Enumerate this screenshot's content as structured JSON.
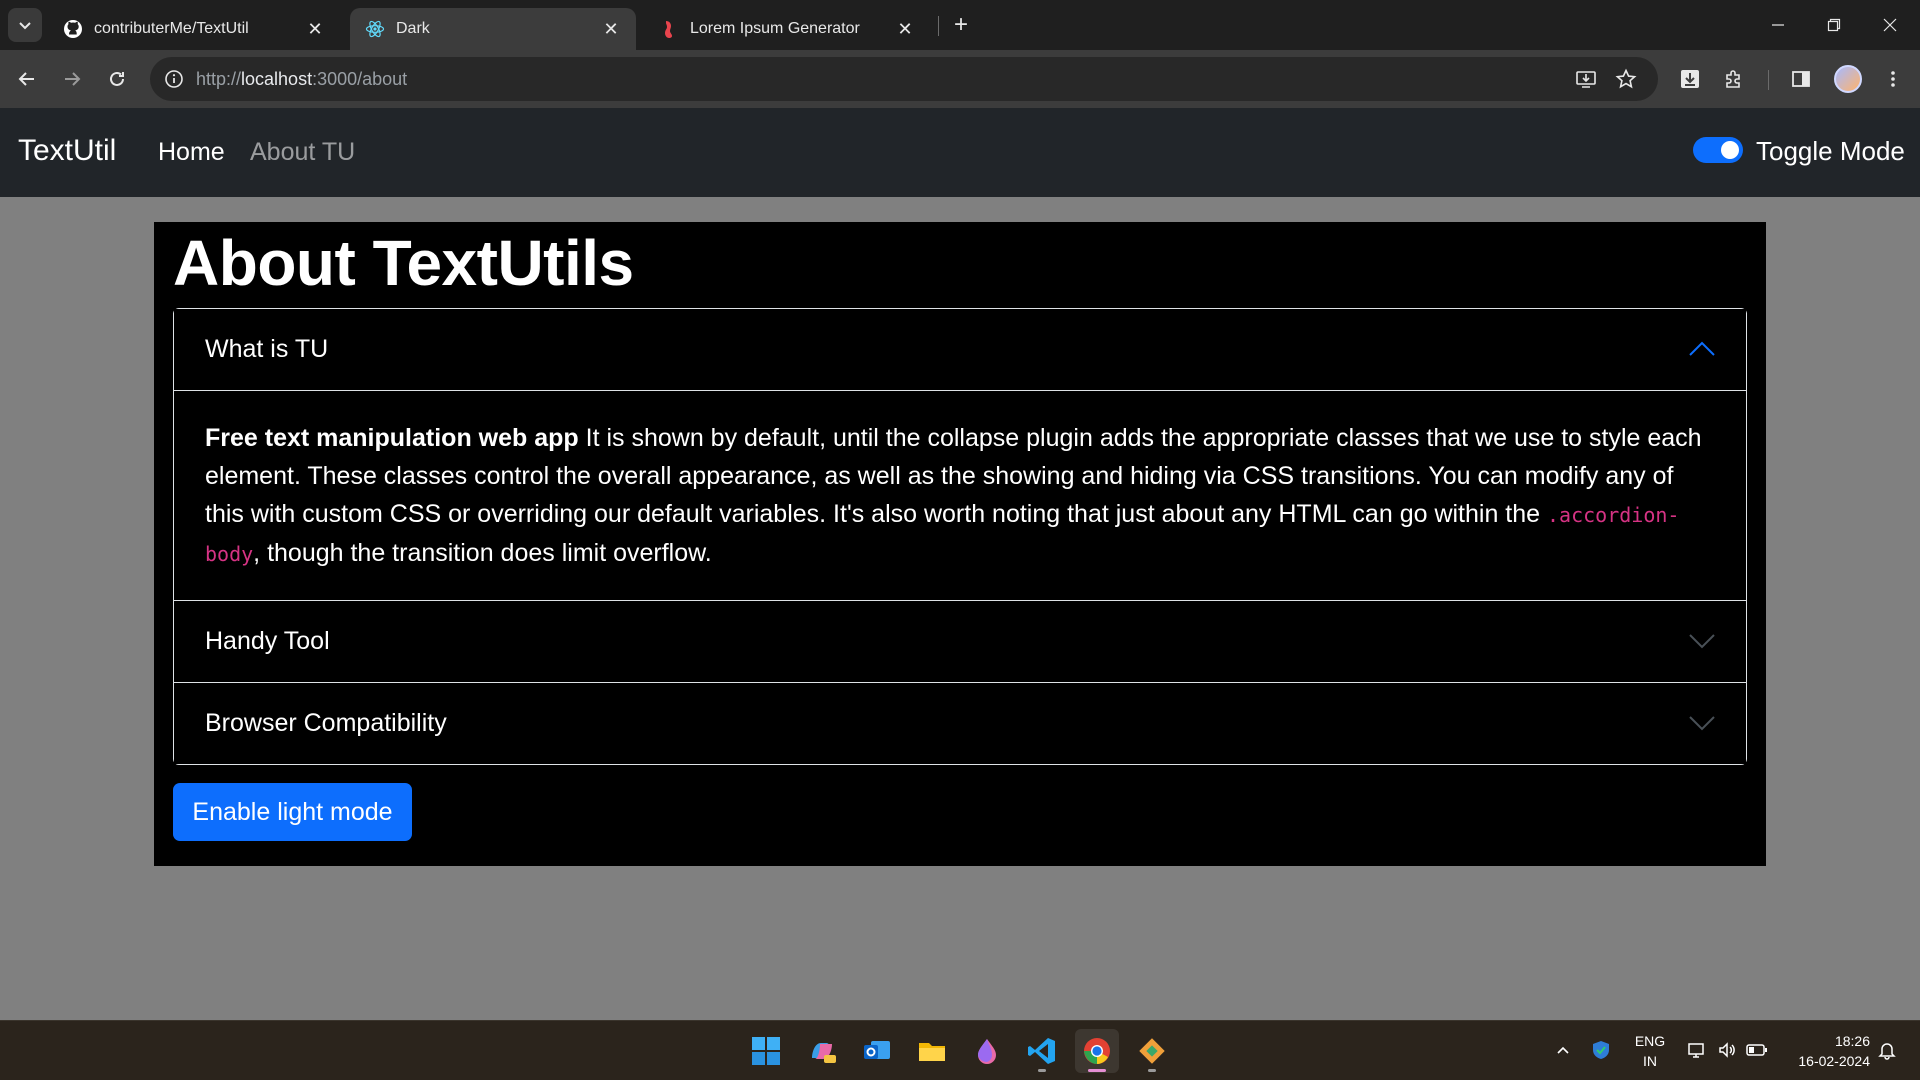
{
  "browser": {
    "tabs": [
      {
        "title": "contributerMe/TextUtil",
        "favicon": "github-icon",
        "active": false
      },
      {
        "title": "Dark",
        "favicon": "react-icon",
        "active": true
      },
      {
        "title": "Lorem Ipsum Generator",
        "favicon": "lorem-ipsum-icon",
        "active": false
      }
    ],
    "url_prefix": "http://",
    "url_host": "localhost",
    "url_path": ":3000/about"
  },
  "navbar": {
    "brand": "TextUtil",
    "links": [
      {
        "label": "Home",
        "active": true
      },
      {
        "label": "About TU",
        "active": false
      }
    ],
    "toggle_label": "Toggle Mode",
    "toggle_on": true
  },
  "main": {
    "heading": "About TextUtils",
    "accordion": [
      {
        "header": "What is TU",
        "expanded": true,
        "body_bold": "Free text manipulation web app",
        "body_text": " It is shown by default, until the collapse plugin adds the appropriate classes that we use to style each element. These classes control the overall appearance, as well as the showing and hiding via CSS transitions. You can modify any of this with custom CSS or overriding our default variables. It's also worth noting that just about any HTML can go within the ",
        "body_code": ".accordion-body",
        "body_tail": ", though the transition does limit overflow."
      },
      {
        "header": "Handy Tool",
        "expanded": false
      },
      {
        "header": "Browser Compatibility",
        "expanded": false
      }
    ],
    "button_label": "Enable light mode"
  },
  "taskbar": {
    "lang_top": "ENG",
    "lang_bottom": "IN",
    "time": "18:26",
    "date": "16-02-2024"
  },
  "colors": {
    "accent": "#0d6efd",
    "navbar_bg": "#212529",
    "page_bg": "#808080",
    "container_bg": "#000000",
    "code": "#d63384"
  }
}
